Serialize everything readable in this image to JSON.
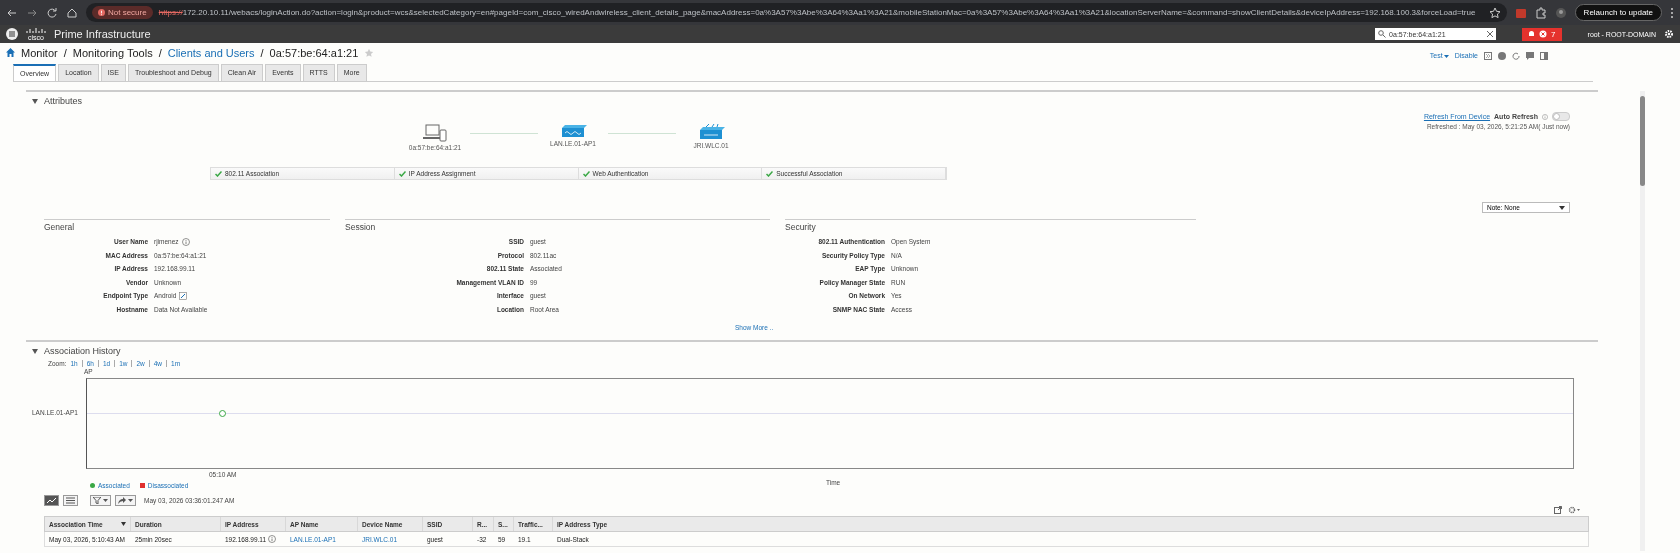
{
  "browser": {
    "security": "Not secure",
    "url_scheme": "https://",
    "url": "172.20.10.11/webacs/loginAction.do?action=login&product=wcs&selectedCategory=en#pageId=com_cisco_wiredAndwireless_client_details_page&macAddress=0a%3A57%3Abe%3A64%3Aa1%3A21&mobileStationMac=0a%3A57%3Abe%3A64%3Aa1%3A21&locationServerName=&command=showClientDetails&deviceIpAddress=192.168.100.3&forceLoad=true",
    "relaunch": "Relaunch to update"
  },
  "header": {
    "logo_text": "cisco",
    "product": "Prime Infrastructure",
    "search_value": "0a:57:be:64:a1:21",
    "alarm_count": "7",
    "user": "root - ROOT-DOMAIN"
  },
  "breadcrumb_separator": "/",
  "breadcrumb": [
    {
      "label": "Monitor",
      "link": false
    },
    {
      "label": "Monitoring Tools",
      "link": false
    },
    {
      "label": "Clients and Users",
      "link": true
    },
    {
      "label": "0a:57:be:64:a1:21",
      "link": false
    }
  ],
  "page_actions": {
    "test": "Test",
    "disable": "Disable"
  },
  "tabs": [
    {
      "label": "Overview",
      "selected": true
    },
    {
      "label": "Location",
      "selected": false
    },
    {
      "label": "ISE",
      "selected": false
    },
    {
      "label": "Troubleshoot and Debug",
      "selected": false
    },
    {
      "label": "Clean Air",
      "selected": false
    },
    {
      "label": "Events",
      "selected": false
    },
    {
      "label": "RTTS",
      "selected": false
    },
    {
      "label": "More",
      "selected": false
    }
  ],
  "attributes": {
    "title": "Attributes",
    "expanded": true,
    "refresh_link": "Refresh From Device",
    "auto_refresh_label": "Auto Refresh",
    "auto_refresh_on": false,
    "refreshed": "Refreshed : May 03, 2026, 5:21:25 AM( Just now)",
    "topology": [
      {
        "kind": "client",
        "label": "0a:57:be:64:a1:21"
      },
      {
        "kind": "ap",
        "label": "LAN.LE.01-AP1"
      },
      {
        "kind": "controller",
        "label": "JRI.WLC.01"
      }
    ],
    "steps": [
      {
        "label": "802.11 Association",
        "done": true
      },
      {
        "label": "IP Address Assignment",
        "done": true
      },
      {
        "label": "Web Authentication",
        "done": true
      },
      {
        "label": "Successful Association",
        "done": true
      }
    ],
    "note": "Note: None",
    "sections": [
      {
        "title": "General",
        "fields": [
          {
            "label": "User Name",
            "value": "rjimenez",
            "kind": "info"
          },
          {
            "label": "MAC Address",
            "value": "0a:57:be:64:a1:21",
            "kind": "plain"
          },
          {
            "label": "IP Address",
            "value": "192.168.99.11",
            "kind": "plain"
          },
          {
            "label": "Vendor",
            "value": "Unknown",
            "kind": "plain"
          },
          {
            "label": "Endpoint Type",
            "value": "Android",
            "kind": "edit"
          },
          {
            "label": "Hostname",
            "value": "Data Not Available",
            "kind": "plain"
          }
        ]
      },
      {
        "title": "Session",
        "fields": [
          {
            "label": "SSID",
            "value": "guest"
          },
          {
            "label": "Protocol",
            "value": "802.11ac"
          },
          {
            "label": "802.11 State",
            "value": "Associated"
          },
          {
            "label": "Management VLAN ID",
            "value": "99"
          },
          {
            "label": "Interface",
            "value": "guest"
          },
          {
            "label": "Location",
            "value": "Root Area"
          }
        ]
      },
      {
        "title": "Security",
        "fields": [
          {
            "label": "802.11 Authentication",
            "value": "Open System"
          },
          {
            "label": "Security Policy Type",
            "value": "N/A"
          },
          {
            "label": "EAP Type",
            "value": "Unknown"
          },
          {
            "label": "Policy Manager State",
            "value": "RUN"
          },
          {
            "label": "On Network",
            "value": "Yes"
          },
          {
            "label": "SNMP NAC State",
            "value": "Access"
          }
        ],
        "show_more": "Show More .."
      }
    ]
  },
  "association_history": {
    "title": "Association History",
    "expanded": true,
    "zoom_label": "Zoom:",
    "zoom_options": [
      "1h",
      "6h",
      "1d",
      "1w",
      "2w",
      "4w",
      "1m"
    ],
    "chart": {
      "y_title": "AP",
      "y_category": "LAN.LE.01-AP1",
      "x_tick": "05:10 AM",
      "x_title": "Time"
    },
    "legend": [
      {
        "label": "Associated",
        "color": "#3aa845"
      },
      {
        "label": "Disassociated",
        "color": "#e0302e"
      }
    ],
    "timestamp": "May 03, 2026 03:36:01.247 AM",
    "table": {
      "columns": [
        {
          "label": "Association Time",
          "sorted": true,
          "kind": "text"
        },
        {
          "label": "Duration",
          "sorted": false,
          "kind": "text"
        },
        {
          "label": "IP Address",
          "sorted": false,
          "kind": "info"
        },
        {
          "label": "AP Name",
          "sorted": false,
          "kind": "link"
        },
        {
          "label": "Device Name",
          "sorted": false,
          "kind": "link"
        },
        {
          "label": "SSID",
          "sorted": false,
          "kind": "text"
        },
        {
          "label": "R...",
          "sorted": false,
          "kind": "text"
        },
        {
          "label": "S...",
          "sorted": false,
          "kind": "text"
        },
        {
          "label": "Traffic...",
          "sorted": false,
          "kind": "text"
        },
        {
          "label": "IP Address Type",
          "sorted": false,
          "kind": "text"
        }
      ],
      "rows": [
        [
          "May 03, 2026, 5:10:43 AM",
          "25min 20sec",
          "192.168.99.11",
          "LAN.LE.01-AP1",
          "JRI.WLC.01",
          "guest",
          "-32",
          "59",
          "19.1",
          "Dual-Stack"
        ]
      ]
    }
  }
}
